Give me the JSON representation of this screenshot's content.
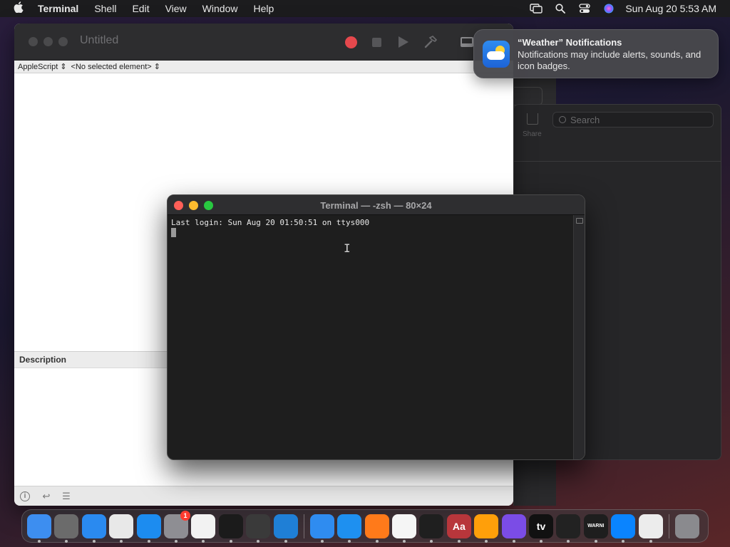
{
  "menubar": {
    "app_name": "Terminal",
    "menus": [
      "Shell",
      "Edit",
      "View",
      "Window",
      "Help"
    ],
    "clock": "Sun Aug 20  5:53 AM"
  },
  "script_editor": {
    "title": "Untitled",
    "language_popup": "AppleScript",
    "element_popup": "<No selected element>",
    "description_label": "Description"
  },
  "back_window": {
    "share_label": "Share",
    "search_placeholder": "Search"
  },
  "terminal": {
    "title": "Terminal — -zsh — 80×24",
    "last_login_line": "Last login: Sun Aug 20 01:50:51 on ttys000"
  },
  "notification": {
    "title": "“Weather” Notifications",
    "body": "Notifications may include alerts, sounds, and icon badges."
  },
  "dock": {
    "apps": [
      {
        "name": "finder",
        "color": "#3d8ef0"
      },
      {
        "name": "launchpad",
        "color": "#6b6b6b"
      },
      {
        "name": "safari",
        "color": "#2a8af0"
      },
      {
        "name": "chrome",
        "color": "#e8e8e8"
      },
      {
        "name": "app-store",
        "color": "#1c8cf0"
      },
      {
        "name": "system-settings",
        "color": "#8e8e93",
        "badge": "1"
      },
      {
        "name": "textedit",
        "color": "#f2f2f2"
      },
      {
        "name": "terminal",
        "color": "#1b1b1b"
      },
      {
        "name": "garageband",
        "color": "#3a3a3a"
      },
      {
        "name": "vscode",
        "color": "#1f7fd6"
      },
      {
        "name": "weather",
        "color": "#2f8cf0"
      },
      {
        "name": "keynote",
        "color": "#1e90f0"
      },
      {
        "name": "firefox",
        "color": "#ff7a1a"
      },
      {
        "name": "freeform",
        "color": "#f5f5f5"
      },
      {
        "name": "voice-memos",
        "color": "#1f1f1f"
      },
      {
        "name": "dictionary",
        "color": "#b8363b",
        "text": "Aa"
      },
      {
        "name": "home",
        "color": "#ff9f0a"
      },
      {
        "name": "podcasts-creator",
        "color": "#7b4ce6"
      },
      {
        "name": "apple-tv",
        "color": "#111111",
        "text": "tv"
      },
      {
        "name": "activity-monitor",
        "color": "#222222"
      },
      {
        "name": "console",
        "color": "#1e1e1e",
        "text": "WARNI"
      },
      {
        "name": "bluetooth-screen-sharing",
        "color": "#0a84ff"
      },
      {
        "name": "script-editor",
        "color": "#ececec"
      }
    ],
    "trash": {
      "name": "trash",
      "color": "#8a8a8e"
    }
  }
}
